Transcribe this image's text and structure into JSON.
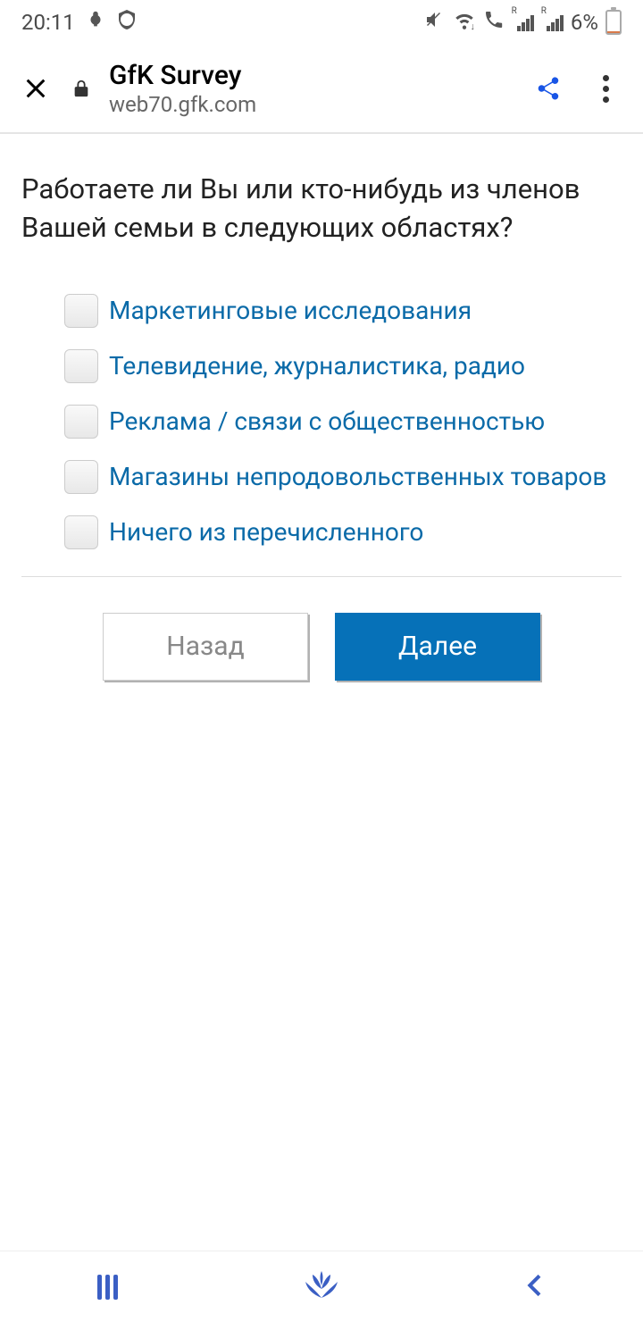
{
  "status": {
    "time": "20:11",
    "battery_pct": "6%"
  },
  "browser": {
    "title": "GfK Survey",
    "url": "web70.gfk.com"
  },
  "survey": {
    "question": "Работаете ли Вы или кто-нибудь из членов Вашей семьи в следующих областях?",
    "options": [
      {
        "label": "Маркетинговые исследования"
      },
      {
        "label": "Телевидение, журналистика, радио"
      },
      {
        "label": "Реклама / связи с общественностью"
      },
      {
        "label": "Магазины непродовольственных товаров"
      },
      {
        "label": "Ничего из перечисленного"
      }
    ],
    "back_label": "Назад",
    "next_label": "Далее"
  }
}
